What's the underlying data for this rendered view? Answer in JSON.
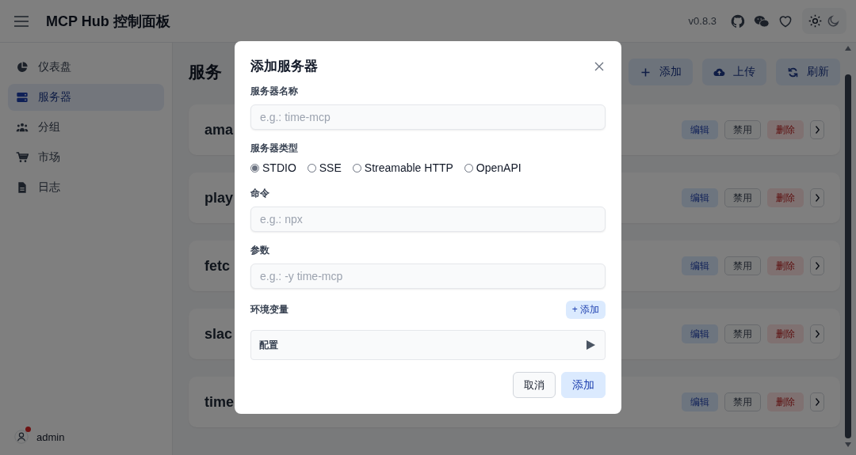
{
  "header": {
    "title": "MCP Hub 控制面板",
    "version": "v0.8.3",
    "theme_options": [
      {
        "kind": "light",
        "selected": true
      },
      {
        "kind": "dark",
        "selected": false
      }
    ]
  },
  "sidebar": {
    "items": [
      {
        "label": "仪表盘",
        "selected": false
      },
      {
        "label": "服务器",
        "selected": true
      },
      {
        "label": "分组",
        "selected": false
      },
      {
        "label": "市场",
        "selected": false
      },
      {
        "label": "日志",
        "selected": false
      }
    ],
    "user": {
      "name": "admin",
      "notification": true
    }
  },
  "main": {
    "title": "服务",
    "actions": [
      {
        "label": "添加"
      },
      {
        "label": "上传"
      },
      {
        "label": "刷新"
      }
    ],
    "servers": [
      {
        "name": "ama",
        "actions": [
          {
            "kind": "edit",
            "label": "编辑"
          },
          {
            "kind": "disable",
            "label": "禁用"
          },
          {
            "kind": "delete",
            "label": "删除"
          }
        ]
      },
      {
        "name": "play",
        "actions": [
          {
            "kind": "edit",
            "label": "编辑"
          },
          {
            "kind": "disable",
            "label": "禁用"
          },
          {
            "kind": "delete",
            "label": "删除"
          }
        ]
      },
      {
        "name": "fetc",
        "actions": [
          {
            "kind": "edit",
            "label": "编辑"
          },
          {
            "kind": "disable",
            "label": "禁用"
          },
          {
            "kind": "delete",
            "label": "删除"
          }
        ]
      },
      {
        "name": "slac",
        "actions": [
          {
            "kind": "edit",
            "label": "编辑"
          },
          {
            "kind": "disable",
            "label": "禁用"
          },
          {
            "kind": "delete",
            "label": "删除"
          }
        ]
      },
      {
        "name": "time",
        "actions": [
          {
            "kind": "edit",
            "label": "编辑"
          },
          {
            "kind": "disable",
            "label": "禁用"
          },
          {
            "kind": "delete",
            "label": "删除"
          }
        ]
      }
    ]
  },
  "dialog": {
    "title": "添加服务器",
    "name_field": {
      "label": "服务器名称",
      "placeholder": "e.g.: time-mcp"
    },
    "type_field": {
      "label": "服务器类型",
      "options": [
        {
          "label": "STDIO",
          "selected": true
        },
        {
          "label": "SSE",
          "selected": false
        },
        {
          "label": "Streamable HTTP",
          "selected": false
        },
        {
          "label": "OpenAPI",
          "selected": false
        }
      ]
    },
    "command_field": {
      "label": "命令",
      "placeholder": "e.g.: npx"
    },
    "args_field": {
      "label": "参数",
      "placeholder": "e.g.: -y time-mcp"
    },
    "env": {
      "label": "环境变量",
      "add_button": "+ 添加"
    },
    "config": {
      "label": "配置",
      "expanded": false
    },
    "buttons": [
      {
        "kind": "secondary",
        "label": "取消"
      },
      {
        "kind": "primary",
        "label": "添加"
      }
    ]
  }
}
